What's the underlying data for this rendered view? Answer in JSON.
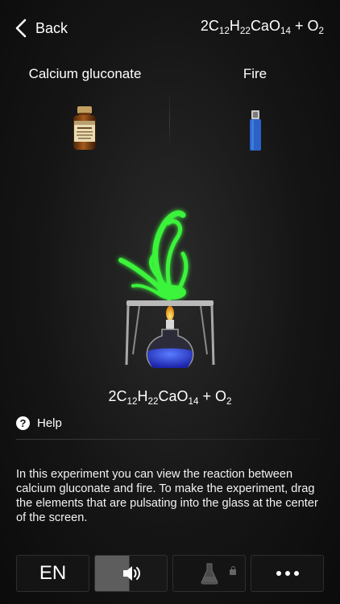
{
  "header": {
    "back_label": "Back",
    "formula": {
      "coef": "2C",
      "s1": "12",
      "h": "H",
      "s2": "22",
      "ca": "CaO",
      "s3": "14",
      "plus": " + O",
      "s4": "2"
    }
  },
  "reagents": [
    {
      "name": "Calcium gluconate",
      "icon": "calcium-bottle-icon"
    },
    {
      "name": "Fire",
      "icon": "lighter-icon"
    }
  ],
  "result": {
    "formula": {
      "coef": "2C",
      "s1": "12",
      "h": "H",
      "s2": "22",
      "ca": "CaO",
      "s3": "14",
      "plus": " + O",
      "s4": "2"
    }
  },
  "help": {
    "icon_text": "?",
    "label": "Help"
  },
  "description": "In this experiment you can view the reaction between calcium gluconate and fire. To make the experiment, drag the elements that are pulsating into the glass at the center of the screen.",
  "toolbar": {
    "language": "EN",
    "sound_icon": "speaker-icon",
    "flask_icon": "flask-icon",
    "locked": true,
    "more_icon": "more-dots-icon"
  },
  "colors": {
    "flame": "#3cff3c",
    "liquid": "#2a3fd8",
    "background": "#151515"
  }
}
